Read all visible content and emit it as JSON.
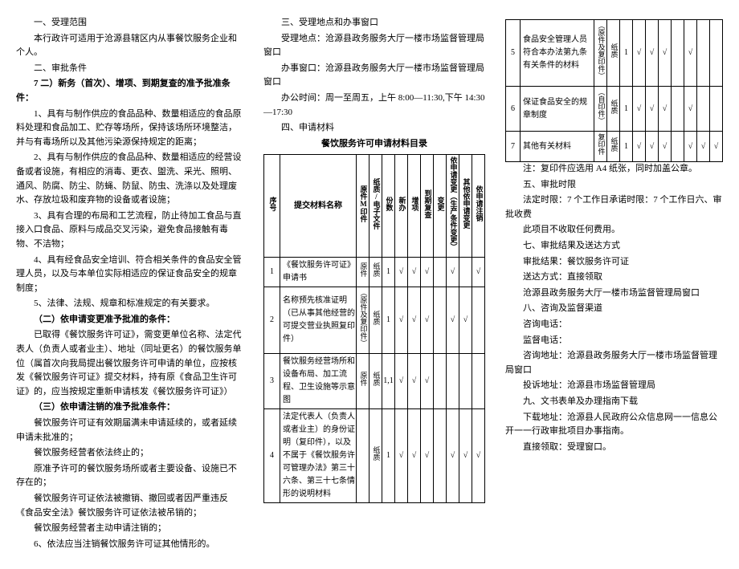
{
  "col1": {
    "h1": "一、受理范围",
    "p1": "本行政许可适用于沧源县辖区内从事餐饮服务企业和个人。",
    "h2": "二、审批条件",
    "p2_bold": "7 二）新务（首次）、增项、到期复查的准予批准条件：",
    "p3": "1、具有与制作供应的食品品种、数量相适应的食品原料处理和食品加工、贮存等场所，保持该场所环境整洁，并与有毒场所以及其他污染源保持规定的距离；",
    "p4": "2、具有与制作供应的食品品种、数量相适应的经营设备或者设施，有相应的消毒、更衣、盥洗、采光、照明、通风、防腐、防尘、防蝇、防鼠、防虫、洗涤以及处理废水、存放垃圾和废弃物的设备或者设施；",
    "p5": "3、具有合理的布局和工艺流程，防止待加工食品与直接入口食品、原料与成品交叉污染，避免食品接触有毒物、不洁物；",
    "p6": "4、具有经食品安全培训、符合相关条件的食品安全管理人员，以及与本单位实际相适应的保证食品安全的规章制度；",
    "p7": "5、法律、法规、规章和标准规定的有关要求。",
    "p8_bold": "（二）依申请变更准予批准的条件：",
    "p9": "已取得《餐饮服务许可证》，需变更单位名称、法定代表人（负责人或者业主）、地址（同址更名）的餐饮服务单位（属首次向我局提出餐饮服务许可申请的单位，应按核发《餐饮服务许可证》提交材料，持有原《食品卫生许可证》的，应当按规定重新申请核发《餐饮服务许可证》）",
    "p10_bold": "（三）依申请注销的准予批准条件：",
    "p11": "餐饮服务许可证有效期届满未申请延续的，或者延续申请未批准的；",
    "p12": "餐饮服务经营者依法终止的；",
    "p13": "原准予许可的餐饮服务场所或者主要设备、设施已不存在的；",
    "p14": "餐饮服务许可证依法被撤销、撤回或者因严重违反《食品安全法》餐饮服务许可证依法被吊销的；",
    "p15": "餐饮服务经营者主动申请注销的；",
    "p16": "6、依法应当注销餐饮服务许可证其他情形的。"
  },
  "col2": {
    "h3": "三、受理地点和办事窗口",
    "p1": "受理地点：沧源县政务服务大厅一楼市场监督管理局窗口",
    "p2": "办事窗口：沧源县政务服务大厅一楼市场监督管理局窗口",
    "p3": "办公时间：周一至周五，上午 8:00—11:30,下午 14:30—17:30",
    "h4": "四、申请材料",
    "table_title": "餐饮服务许可申请材料目录",
    "headers": {
      "seq": "序号",
      "name": "提交材料名称",
      "orig": "原件M印件",
      "form": "纸质/电子文件",
      "copies": "份数",
      "new": "新办",
      "add": "增项",
      "recheck": "到期复查",
      "change": "变更",
      "change_biz": "依申请变更（生产条件变更）",
      "other": "其他依申请变更",
      "cancel": "依申请注销"
    },
    "rows": [
      {
        "seq": "1",
        "name": "《餐饮服务许可证》申请书",
        "c3": "原件",
        "c4": "纸质",
        "c5": "1",
        "c6": "√",
        "c7": "√",
        "c8": "√",
        "c10": "√",
        "c12": "√"
      },
      {
        "seq": "2",
        "name": "名称预先核准证明（已从事其他经营的可提交营业执照复印件）",
        "c3": "（原件及复印件）",
        "c4": "纸质",
        "c5": "1",
        "c6": "√",
        "c7": "√",
        "c8": "√",
        "c10": "√",
        "c11": "√"
      },
      {
        "seq": "3",
        "name": "餐饮服务经营场所和设备布局、加工流程、卫生设施等示意图",
        "c3": "原件",
        "c4": "纸质",
        "c5": "1,1",
        "c6": "√",
        "c7": "√",
        "c8": "√"
      },
      {
        "seq": "4",
        "name": "法定代表人（负责人或者业主）的身份证明（复印件），以及不属于《餐饮服务许可管理办法》第三十六条、第三十七条情形的说明材料",
        "c3": "",
        "c4": "纸质",
        "c5": "1",
        "c6": "√",
        "c7": "√",
        "c8": "√",
        "c10": "√",
        "c11": "√",
        "c12": "√"
      }
    ]
  },
  "col3": {
    "rows": [
      {
        "seq": "5",
        "name": "食品安全管理人员符合本办法第九条有关条件的材料",
        "c3": "（原件及复印件）",
        "c4": "纸质",
        "c5": "1",
        "c6": "√",
        "c7": "√",
        "c8": "√",
        "c10": "√"
      },
      {
        "seq": "6",
        "name": "保证食品安全的规章制度",
        "c3": "（自印件）",
        "c4": "纸质",
        "c5": "1",
        "c6": "√",
        "c7": "√",
        "c8": "√",
        "c10": "√"
      },
      {
        "seq": "7",
        "name": "其他有关材料",
        "c3": "复印件",
        "c4": "纸质",
        "c5": "1",
        "c6": "√",
        "c7": "√",
        "c8": "√",
        "c10": "√",
        "c11": "√",
        "c12": "√"
      }
    ],
    "note": "注：复印件应选用 A4 纸张，同时加盖公章。",
    "h5": "五、审批时限",
    "p5a": "法定时限：7 个工作日承诺时限：7 个工作日六、审批收费",
    "p6a": "此项目不收取任何费用。",
    "h7": "七、审批结果及送达方式",
    "p7a": "审批结果：餐饮服务许可证",
    "p7b": "送达方式：直接领取",
    "p7c": "沧源县政务服务大厅一楼市场监督管理局窗口",
    "h8": "八、咨询及监督渠道",
    "p8a": "咨询电话：",
    "p8b": "监督电话：",
    "p8c": "咨询地址：沧源县政务服务大厅一楼市场监督管理局窗口",
    "p8d": "投诉地址：沧源县市场监督管理局",
    "h9": "九、文书表单及办理指南下载",
    "p9a": "下载地址：沧源县人民政府公众信息网一一信息公开一一行政审批项目办事指南。",
    "p9b": "直接领取：受理窗口。"
  }
}
